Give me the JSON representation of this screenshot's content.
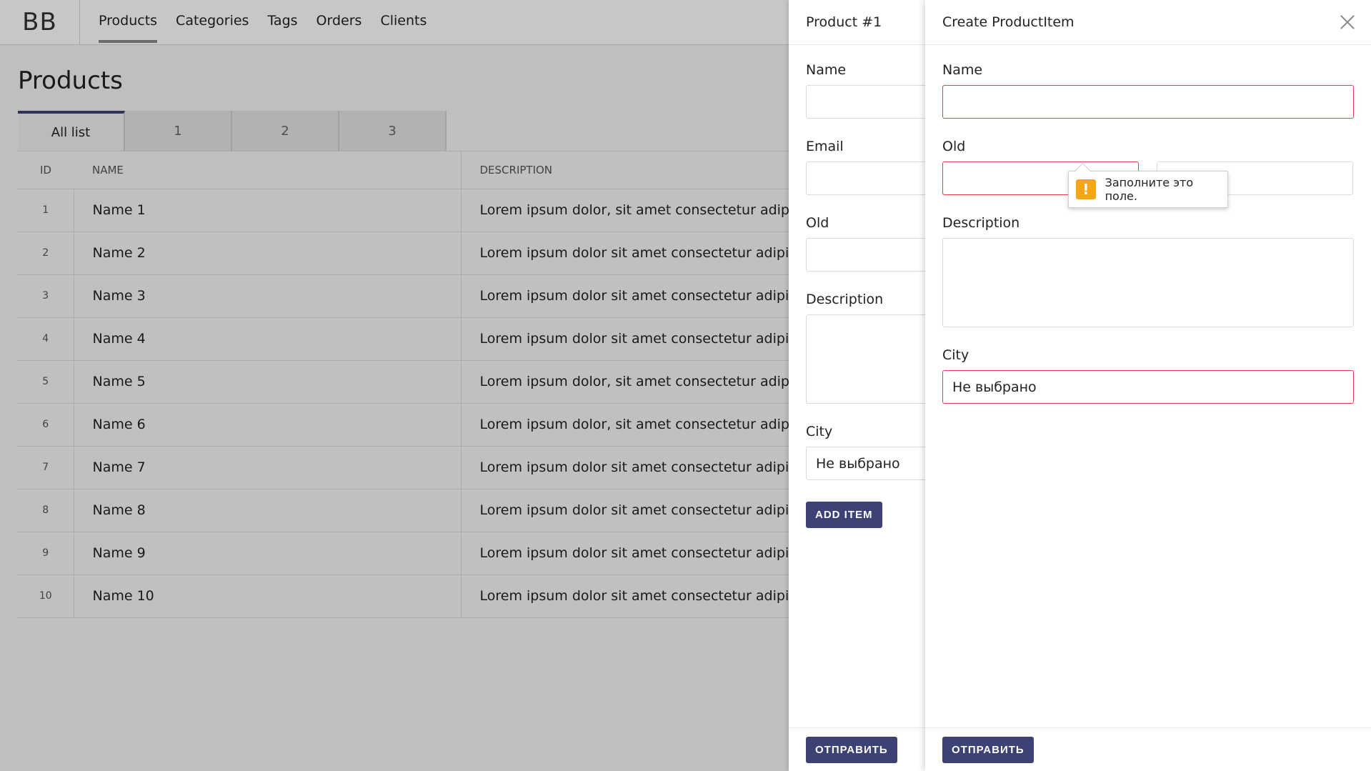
{
  "app": {
    "logo": "BB"
  },
  "nav": [
    "Products",
    "Categories",
    "Tags",
    "Orders",
    "Clients"
  ],
  "page": {
    "title": "Products"
  },
  "tabs": [
    "All list",
    "1",
    "2",
    "3"
  ],
  "table": {
    "headers": [
      "ID",
      "NAME",
      "DESCRIPTION"
    ],
    "rows": [
      {
        "id": "1",
        "name": "Name 1",
        "description": "Lorem ipsum dolor, sit amet consectetur adipisici"
      },
      {
        "id": "2",
        "name": "Name 2",
        "description": "Lorem ipsum dolor sit amet consectetur adipisicir"
      },
      {
        "id": "3",
        "name": "Name 3",
        "description": "Lorem ipsum dolor sit amet consectetur adipisicir"
      },
      {
        "id": "4",
        "name": "Name 4",
        "description": "Lorem ipsum dolor sit amet consectetur adipisicir"
      },
      {
        "id": "5",
        "name": "Name 5",
        "description": "Lorem ipsum dolor, sit amet consectetur adipisici"
      },
      {
        "id": "6",
        "name": "Name 6",
        "description": "Lorem ipsum dolor, sit amet consectetur adipisici"
      },
      {
        "id": "7",
        "name": "Name 7",
        "description": "Lorem ipsum dolor sit amet consectetur adipisicir"
      },
      {
        "id": "8",
        "name": "Name 8",
        "description": "Lorem ipsum dolor sit amet consectetur adipisicir"
      },
      {
        "id": "9",
        "name": "Name 9",
        "description": "Lorem ipsum dolor sit amet consectetur adipisicir"
      },
      {
        "id": "10",
        "name": "Name 10",
        "description": "Lorem ipsum dolor sit amet consectetur adipisicir"
      }
    ]
  },
  "drawer_product": {
    "title": "Product #1",
    "labels": {
      "name": "Name",
      "email": "Email",
      "old": "Old",
      "description": "Description",
      "city": "City"
    },
    "city_value": "Не выбрано",
    "add_item_label": "ADD ITEM",
    "submit_label": "ОТПРАВИТЬ"
  },
  "drawer_create": {
    "title": "Create ProductItem",
    "labels": {
      "name": "Name",
      "old": "Old",
      "description": "Description",
      "city": "City"
    },
    "city_value": "Не выбрано",
    "validation_message": "Заполните это поле.",
    "submit_label": "ОТПРАВИТЬ"
  },
  "colors": {
    "accent": "#3d4275",
    "error": "#e0404a",
    "warning": "#f5a516"
  }
}
